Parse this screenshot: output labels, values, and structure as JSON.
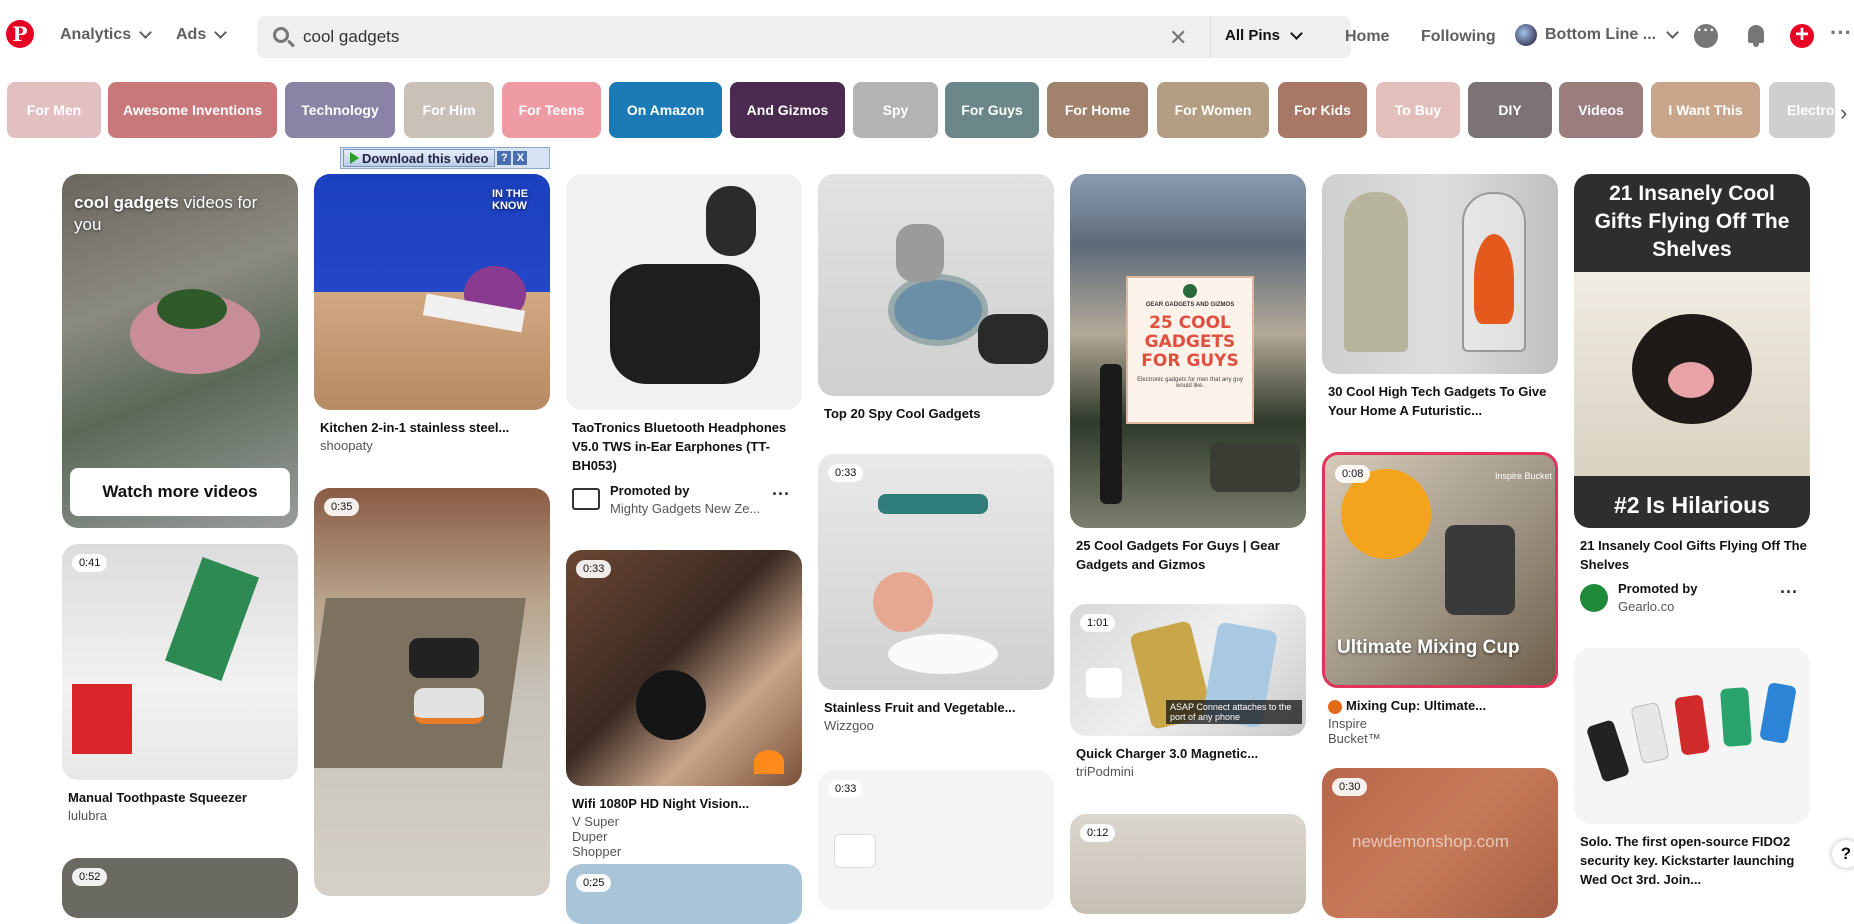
{
  "header": {
    "analytics_label": "Analytics",
    "ads_label": "Ads",
    "search_value": "cool gadgets",
    "filter_label": "All Pins",
    "home_label": "Home",
    "following_label": "Following",
    "profile_label": "Bottom Line ..."
  },
  "chips": [
    {
      "label": "For Men",
      "color": "#e2c0c2"
    },
    {
      "label": "Awesome Inventions",
      "color": "#c8777a"
    },
    {
      "label": "Technology",
      "color": "#8b83a6"
    },
    {
      "label": "For Him",
      "color": "#c9c0b8"
    },
    {
      "label": "For Teens",
      "color": "#ee9ba4"
    },
    {
      "label": "On Amazon",
      "color": "#1b7ab6"
    },
    {
      "label": "And Gizmos",
      "color": "#4a2b4f"
    },
    {
      "label": "Spy",
      "color": "#b3b3b3"
    },
    {
      "label": "For Guys",
      "color": "#6b8788"
    },
    {
      "label": "For Home",
      "color": "#a0826d"
    },
    {
      "label": "For Women",
      "color": "#b39d83"
    },
    {
      "label": "For Kids",
      "color": "#a87765"
    },
    {
      "label": "To Buy",
      "color": "#e2bfbb"
    },
    {
      "label": "DIY",
      "color": "#7c7474"
    },
    {
      "label": "Videos",
      "color": "#9b7d7e"
    },
    {
      "label": "I Want This",
      "color": "#c9a68b"
    },
    {
      "label": "Electro",
      "color": "#cfcfcf"
    }
  ],
  "download_bar": {
    "label": "Download this video",
    "help": "?",
    "close": "X"
  },
  "pins": {
    "videos_card": {
      "title_bold": "cool gadgets",
      "title_rest": " videos for you",
      "button": "Watch more videos"
    },
    "p_squeezer": {
      "badge": "0:41",
      "title": "Manual Toothpaste Squeezer",
      "source": "lulubra"
    },
    "p_col1_bottom": {
      "badge": "0:52"
    },
    "p_kitchen": {
      "overlay": "IN THE KNOW",
      "title": "Kitchen 2-in-1 stainless steel...",
      "source": "shoopaty"
    },
    "p_shoes": {
      "badge": "0:35"
    },
    "p_headphones": {
      "title": "TaoTronics Bluetooth Headphones V5.0 TWS in-Ear Earphones (TT-BH053)",
      "promoted": "Promoted by",
      "advertiser": "Mighty Gadgets New Ze..."
    },
    "p_wifi": {
      "badge": "0:33",
      "title": "Wifi 1080P HD Night Vision...",
      "source": "V Super Duper Shopper"
    },
    "p_col3_bottom": {
      "badge": "0:25"
    },
    "p_spywatch": {
      "title": "Top 20 Spy Cool Gadgets"
    },
    "p_fruit": {
      "badge": "0:33",
      "title": "Stainless Fruit and Vegetable...",
      "source": "Wizzgoo"
    },
    "p_col4_bottom": {
      "badge": "0:33"
    },
    "p_gear": {
      "overlay_top": "GEAR GADGETS AND GIZMOS",
      "overlay_main": "25 COOL GADGETS FOR GUYS",
      "overlay_small": "Electronic gadgets for men that any guy would like.",
      "title": "25 Cool Gadgets For Guys | Gear Gadgets and Gizmos"
    },
    "p_charger": {
      "badge": "1:01",
      "overlay": "ASAP Connect attaches to the port of any phone",
      "title": "Quick Charger 3.0 Magnetic...",
      "source": "triPodmini"
    },
    "p_col5_bottom": {
      "badge": "0:12"
    },
    "p_hightech": {
      "title": "30 Cool High Tech Gadgets To Give Your Home A Futuristic..."
    },
    "p_mixing": {
      "badge": "0:08",
      "watermark": "Inspire Bucket",
      "overlay": "Ultimate Mixing Cup",
      "title": "Mixing Cup: Ultimate...",
      "source": "Inspire Bucket™"
    },
    "p_col6_bottom": {
      "badge": "0:30",
      "watermark": "newdemonshop.com"
    },
    "p_insanely": {
      "overlay_top": "21 Insanely Cool Gifts Flying Off The Shelves",
      "overlay_bottom": "#2 Is Hilarious",
      "title": "21 Insanely Cool Gifts Flying Off The Shelves",
      "promoted": "Promoted by",
      "advertiser": "Gearlo.co"
    },
    "p_solo": {
      "title": "Solo. The first open-source FIDO2 security key. Kickstarter launching Wed Oct 3rd. Join..."
    }
  },
  "help_label": "?"
}
